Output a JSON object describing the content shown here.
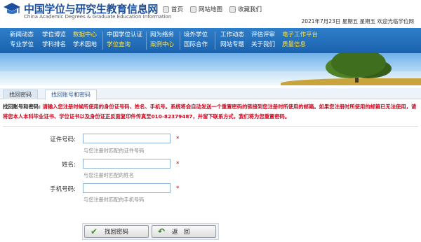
{
  "header": {
    "brand_cn": "中国学位与研究生教育信息网",
    "brand_en": "China Academic Degrees & Graduate Education Information",
    "links": [
      {
        "label": "首页",
        "icon": "home-icon"
      },
      {
        "label": "网站地图",
        "icon": "sitemap-icon"
      },
      {
        "label": "收藏我们",
        "icon": "favorite-icon"
      }
    ],
    "dateline": "2021年7月23日 星期五 星期五 欢迎光临学位网"
  },
  "nav": {
    "columns": [
      [
        "新闻动态",
        "专业学位"
      ],
      [
        "学位博览",
        "学科排名"
      ],
      [
        "数据中心",
        "学术园地"
      ],
      [
        "中国学位认证",
        "学位查询"
      ],
      [
        "网为络务",
        "案例中心"
      ],
      [
        "境外学位",
        "国际合作"
      ],
      [
        "工作动态",
        "网站专题"
      ],
      [
        "评估评审",
        "关于我们"
      ],
      [
        "电子工作平台",
        "质量信息"
      ]
    ],
    "highlight_color": "#ffe14a"
  },
  "tabs": [
    {
      "label": "找回密码",
      "active": false
    },
    {
      "label": "找回账号和密码",
      "active": true
    }
  ],
  "notice": {
    "title": "找回账号和密码:",
    "text": "请输入您注册时候所使用的身份证号码、姓名、手机号。系统将会自动发送一个重置密码的链接到您注册时所使用的邮箱。如果您注册时所使用的邮箱已无法使用，请将您本人本科毕业证书、学位证书以及身份证正反面复印件传真至010-82379487，并留下联系方式，我们将为您重置密码。"
  },
  "form": {
    "fields": [
      {
        "label": "证件号码:",
        "value": "",
        "required": "*",
        "hint": "与您注册时匹配的证件号码"
      },
      {
        "label": "姓名:",
        "value": "",
        "required": "*",
        "hint": "与您注册时匹配的姓名"
      },
      {
        "label": "手机号码:",
        "value": "",
        "required": "*",
        "hint": "与您注册时匹配的手机号码"
      }
    ]
  },
  "buttons": {
    "recover": "找回密码",
    "back": "返　回"
  },
  "colors": {
    "brand": "#1d4f9b",
    "nav": "#1a62ad",
    "alert": "#d0021b"
  }
}
